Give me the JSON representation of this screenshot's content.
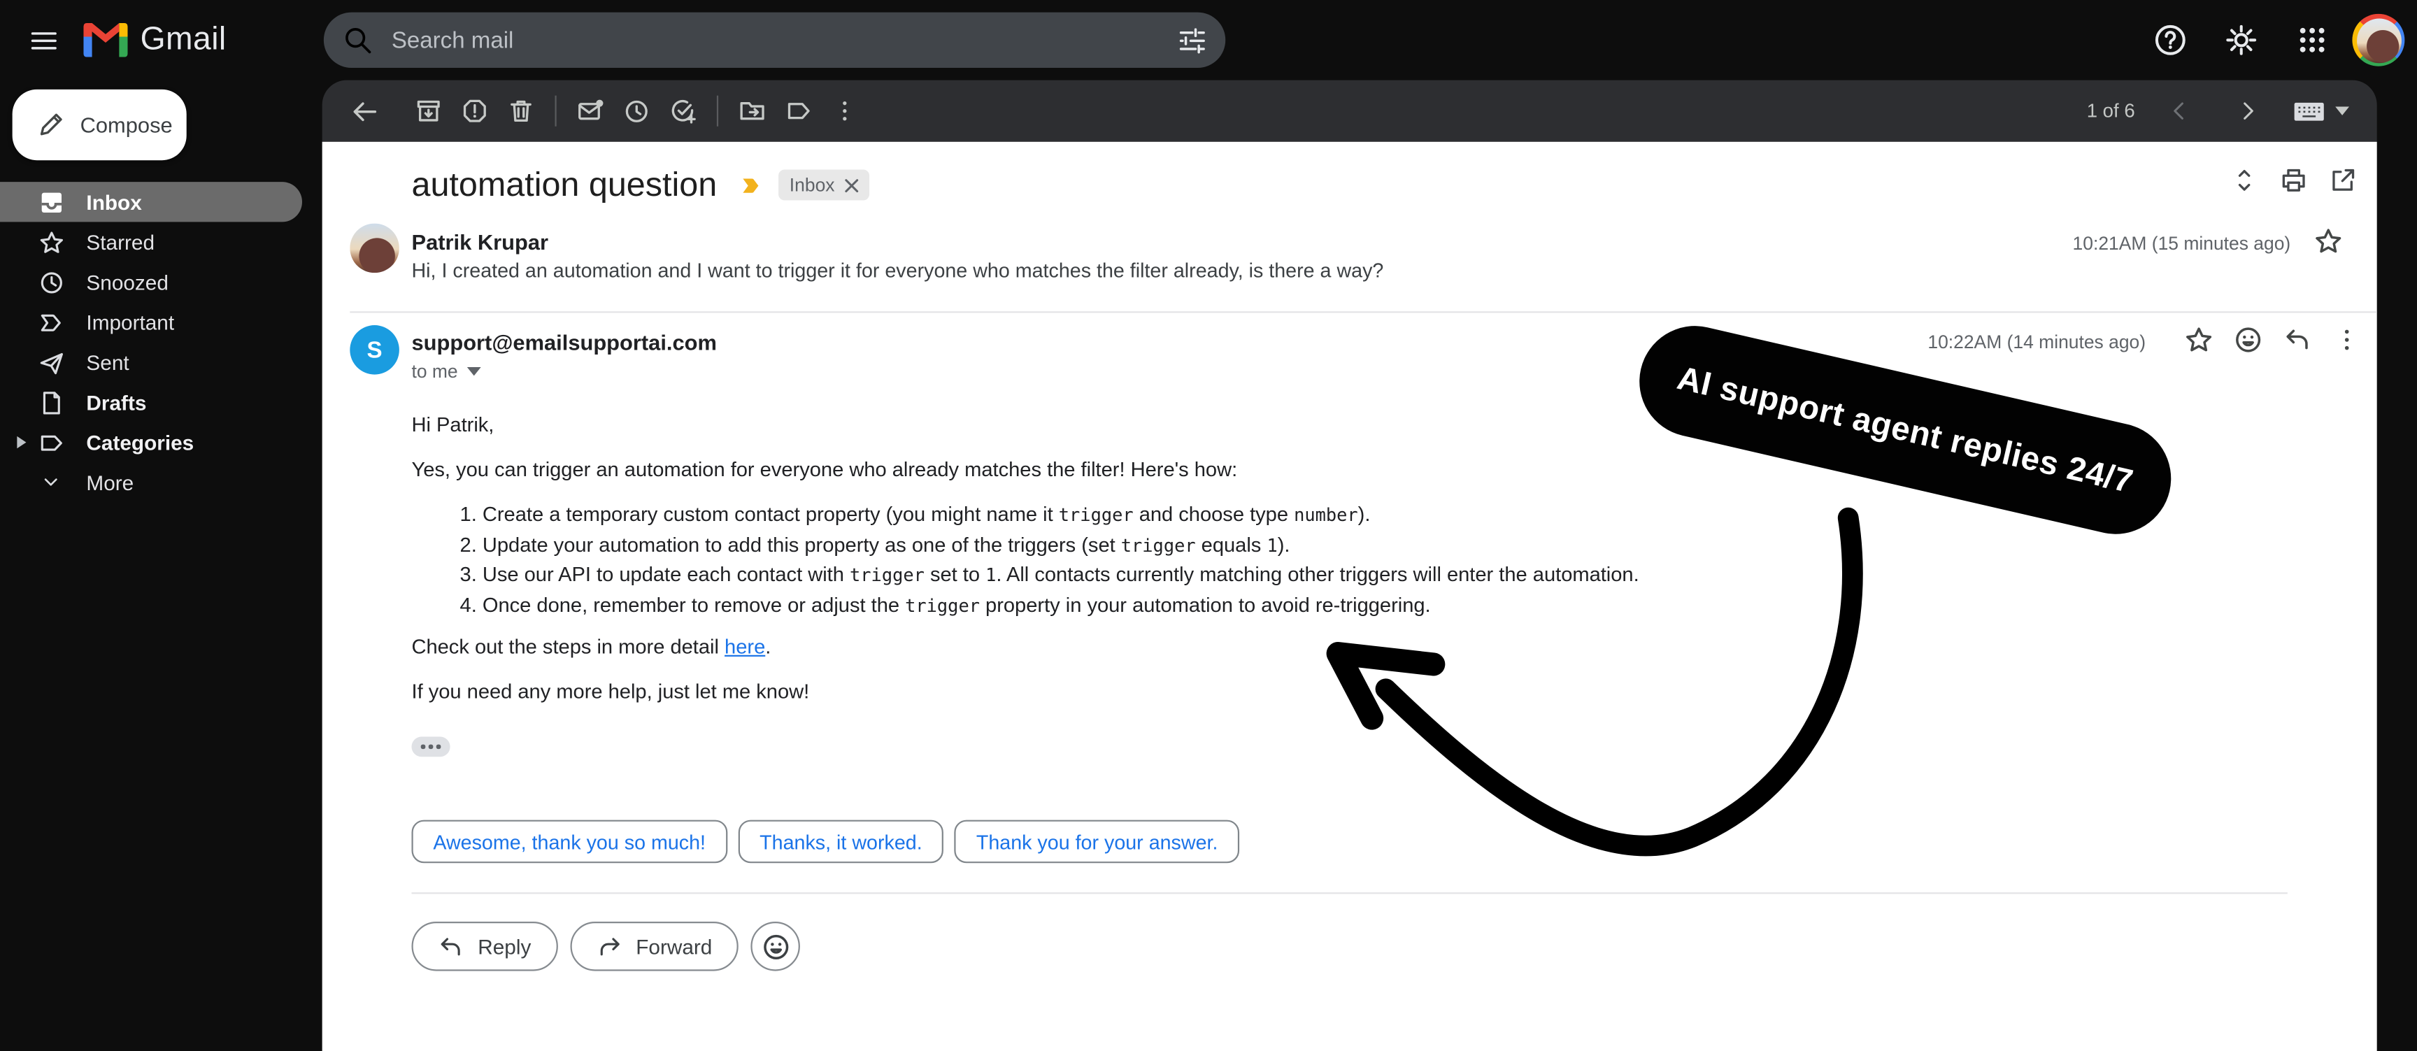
{
  "chrome": {
    "product_name": "Gmail",
    "search_placeholder": "Search mail"
  },
  "sidebar": {
    "compose": "Compose",
    "items": [
      {
        "label": "Inbox"
      },
      {
        "label": "Starred"
      },
      {
        "label": "Snoozed"
      },
      {
        "label": "Important"
      },
      {
        "label": "Sent"
      },
      {
        "label": "Drafts"
      },
      {
        "label": "Categories"
      },
      {
        "label": "More"
      }
    ]
  },
  "toolbar": {
    "pagination": "1 of 6"
  },
  "thread": {
    "subject": "automation question",
    "label_chip": "Inbox"
  },
  "messages": [
    {
      "sender": "Patrik Krupar",
      "snippet": "Hi, I created an automation and I want to trigger it for everyone who matches the filter already, is there a way?",
      "timestamp": "10:21AM (15 minutes ago)"
    },
    {
      "sender": "support@emailsupportai.com",
      "avatar_letter": "S",
      "recipient": "to me",
      "timestamp": "10:22AM (14 minutes ago)",
      "body": {
        "greeting": "Hi Patrik,",
        "intro": "Yes, you can trigger an automation for everyone who already matches the filter! Here's how:",
        "steps": [
          {
            "t1": "Create a temporary custom contact property (you might name it ",
            "c1": "trigger",
            "t2": " and choose type ",
            "c2": "number",
            "t3": ")."
          },
          {
            "t1": "Update your automation to add this property as one of the triggers (set ",
            "c1": "trigger",
            "t2": " equals ",
            "c2": "1",
            "t3": ")."
          },
          {
            "t1": "Use our API to update each contact with ",
            "c1": "trigger",
            "t2": " set to ",
            "c2": "1",
            "t3": ". All contacts currently matching other triggers will enter the automation."
          },
          {
            "t1": "Once done, remember to remove or adjust the ",
            "c1": "trigger",
            "t2": " property in your automation to avoid re-triggering.",
            "c2": "",
            "t3": ""
          }
        ],
        "detail_pre": "Check out the steps in more detail ",
        "detail_link": "here",
        "detail_post": ".",
        "closing": "If you need any more help, just let me know!"
      }
    }
  ],
  "smart_replies": [
    "Awesome, thank you so much!",
    "Thanks, it worked.",
    "Thank you for your answer."
  ],
  "actions": {
    "reply": "Reply",
    "forward": "Forward"
  },
  "annotation": {
    "banner_text": "AI support agent replies 24/7"
  },
  "colors": {
    "accent_blue": "#1a73e8",
    "avatar_blue": "#1a9ce0",
    "important_yellow": "#f2b21d",
    "banner_black": "#020202"
  }
}
